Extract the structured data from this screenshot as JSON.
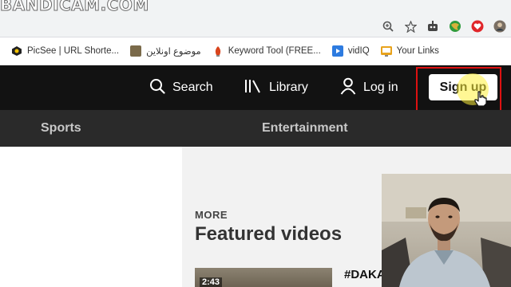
{
  "watermark": {
    "text": "BANDICAM.COM"
  },
  "bookmarks": [
    {
      "label": "PicSee | URL Shorte...",
      "icon": "picsee-icon",
      "color": "#222222"
    },
    {
      "label": "موضوع اونلاين",
      "icon": "site-thumbnail-icon",
      "color": "#7a6a4a"
    },
    {
      "label": "Keyword Tool (FREE...",
      "icon": "keyword-tool-icon",
      "color": "#d9441c"
    },
    {
      "label": "vidIQ",
      "icon": "vidiq-icon",
      "color": "#2d7be0"
    },
    {
      "label": "Your Links",
      "icon": "links-icon",
      "color": "#e8a31c"
    }
  ],
  "topnav": {
    "search_label": "Search",
    "library_label": "Library",
    "login_label": "Log in",
    "signup_label": "Sign up"
  },
  "subnav": {
    "items": [
      "Sports",
      "Entertainment"
    ]
  },
  "featured": {
    "kicker": "MORE",
    "title": "Featured videos",
    "video": {
      "duration": "2:43",
      "tag": "#DAKA"
    }
  },
  "colors": {
    "nav_bg": "#121212",
    "subnav_bg": "#2a2a2a",
    "highlight_frame": "#dd1111",
    "cursor_highlight": "#fff03c"
  }
}
